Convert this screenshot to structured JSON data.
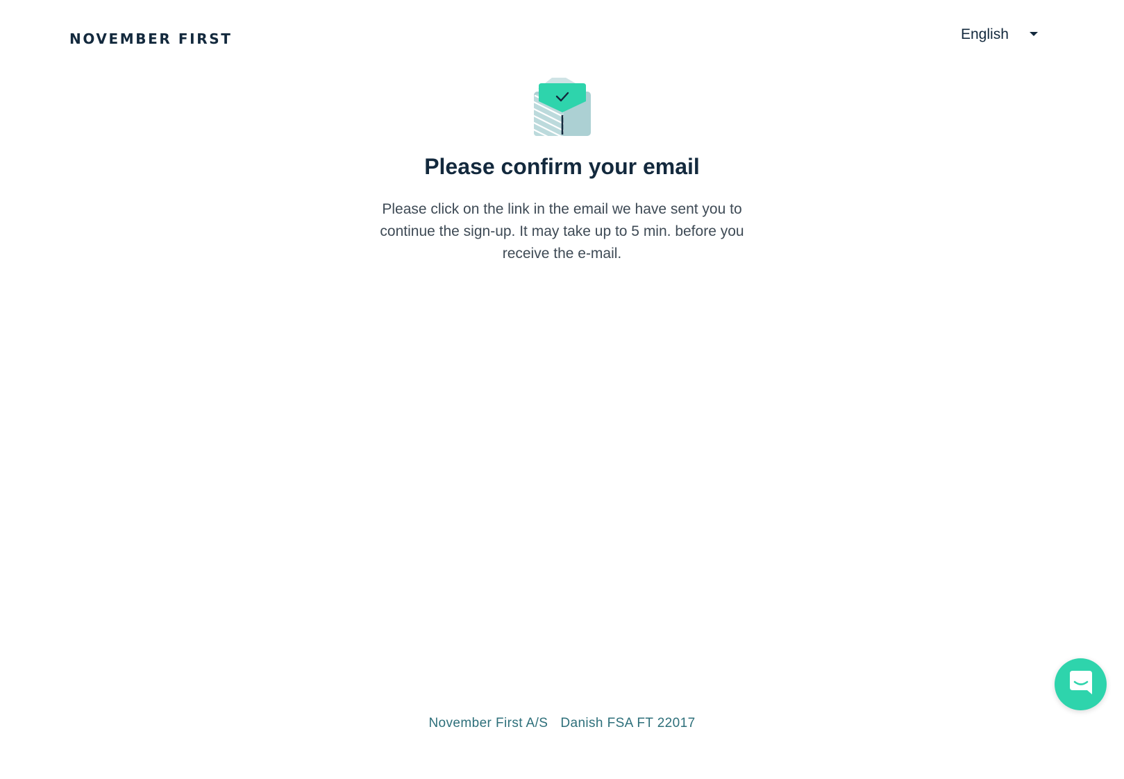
{
  "header": {
    "brand": "NOVEMBER FIRST",
    "language": "English"
  },
  "main": {
    "icon": "envelope-check-icon",
    "title": "Please confirm your email",
    "description": "Please click on the link in the email we have sent you to continue the sign-up. It may take up to 5 min. before you receive the e-mail."
  },
  "footer": {
    "company": "November First A/S",
    "license": "Danish FSA FT 22017"
  },
  "chat": {
    "icon": "chat-bubble-icon"
  },
  "colors": {
    "brand_dark": "#13293d",
    "accent_green": "#2ed4ac",
    "envelope_blue": "#acd0d3",
    "footer_text": "#2d6f7a"
  }
}
